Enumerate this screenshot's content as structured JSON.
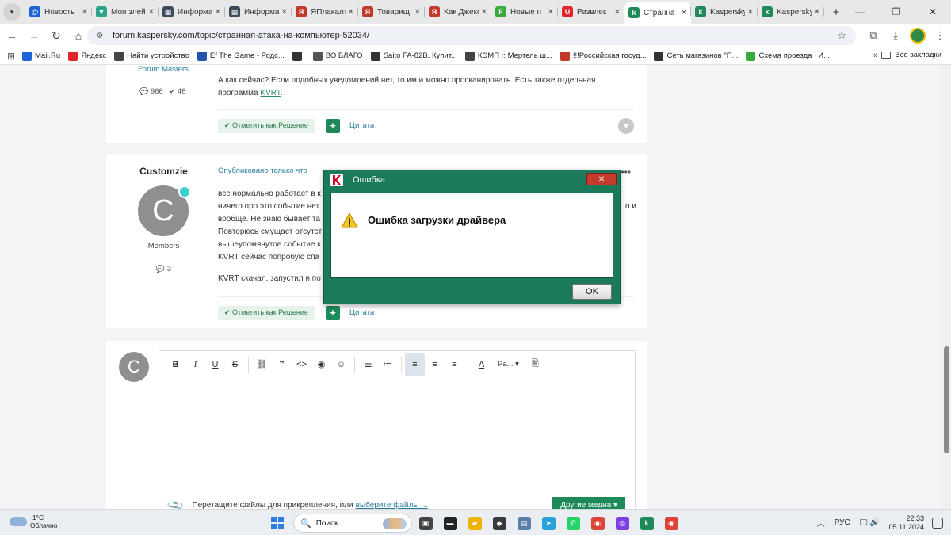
{
  "browser": {
    "tabs": [
      {
        "label": "Новость",
        "icon_char": "@",
        "color": "#1e63d6"
      },
      {
        "label": "Моя злейшая",
        "icon_char": "▼",
        "color": "#2aa58a"
      },
      {
        "label": "Информация",
        "icon_char": "▦",
        "color": "#3a4a5a"
      },
      {
        "label": "Информация",
        "icon_char": "▦",
        "color": "#3a4a5a"
      },
      {
        "label": "ЯПлакалъ",
        "icon_char": "Я",
        "color": "#c0392b"
      },
      {
        "label": "Товарищ",
        "icon_char": "Я",
        "color": "#c0392b"
      },
      {
        "label": "Как Джексон",
        "icon_char": "Я",
        "color": "#c0392b"
      },
      {
        "label": "Новые п",
        "icon_char": "F",
        "color": "#3aa83a"
      },
      {
        "label": "Развлек",
        "icon_char": "U",
        "color": "#e0262b"
      },
      {
        "label": "Странна",
        "icon_char": "k",
        "color": "#1e8a5a"
      },
      {
        "label": "Kaspersky",
        "icon_char": "k",
        "color": "#1e8a5a"
      },
      {
        "label": "Kaspersky",
        "icon_char": "k",
        "color": "#1e8a5a"
      }
    ],
    "active_tab": 9,
    "url": "forum.kaspersky.com/topic/странная-атака-на-компьютер-52034/",
    "bookmarks": [
      {
        "label": "Mail.Ru",
        "color": "#1e63d6"
      },
      {
        "label": "Яндекс",
        "color": "#e0262b"
      },
      {
        "label": "Найти устройство",
        "color": "#444444"
      },
      {
        "label": "Ef The Game - Родс...",
        "color": "#2255aa"
      },
      {
        "label": "",
        "color": "#333333"
      },
      {
        "label": "ВО БЛАГО",
        "color": "#555555"
      },
      {
        "label": "Saito FA-82B. Купит...",
        "color": "#333333"
      },
      {
        "label": "КЭМП :: Мертель ш...",
        "color": "#444444"
      },
      {
        "label": "!!!Российская госуд...",
        "color": "#c0392b"
      },
      {
        "label": "Сеть магазинов \"П...",
        "color": "#333333"
      },
      {
        "label": "Схема проезда | И...",
        "color": "#3aa83a"
      }
    ],
    "bookmarks_more": "»",
    "all_bookmarks": "Все закладки"
  },
  "post1": {
    "author_group": "Forum Masters",
    "posts_count": "966",
    "reputation": "46",
    "text_line1": "А как сейчас? Если подобных уведомлений нет, то им и можно просканировать. Есть также отдельная",
    "text_line2_prefix": "программа ",
    "text_link": "KVRT",
    "text_line2_suffix": ".",
    "solve_label": "✔ Отметить как Решение",
    "quote_label": "Цитата"
  },
  "post2": {
    "author": "Customzie",
    "avatar_letter": "C",
    "group": "Members",
    "posts_count": "3",
    "published": "Опубликовано только что",
    "lines": [
      "все нормально работает в к",
      "ничего про это событие нет",
      "вообще. Не знаю бывает та",
      "Повторюсь смущает отсутст",
      "вышеупомянутое событие к",
      "KVRT сейчас попробую спа"
    ],
    "line_right_1": "о и",
    "line2": "KVRT скачал, запустил и по",
    "solve_label": "✔ Отметить как Решение",
    "quote_label": "Цитата"
  },
  "editor": {
    "avatar_letter": "C",
    "paragraph_combo": "Pa... ▾",
    "attach_text": "Перетащите файлы для прикрепления, или ",
    "attach_link": "выберите файлы ...",
    "media_button": "Другие медиа ▾"
  },
  "dialog": {
    "title": "Ошибка",
    "message": "Ошибка загрузки драйвера",
    "ok_label": "OK",
    "close_label": "✕"
  },
  "taskbar": {
    "temperature": "-1°C",
    "weather": "Облачно",
    "search_placeholder": "Поиск",
    "language": "РУС",
    "time": "22:33",
    "date": "05.11.2024",
    "apps": [
      {
        "name": "task-view",
        "color": "#444444",
        "char": "▣"
      },
      {
        "name": "terminal",
        "color": "#222222",
        "char": "▬"
      },
      {
        "name": "explorer",
        "color": "#f0b400",
        "char": "▰"
      },
      {
        "name": "app-dark",
        "color": "#3a3a3a",
        "char": "◆"
      },
      {
        "name": "photos",
        "color": "#5a7fa8",
        "char": "▤"
      },
      {
        "name": "telegram",
        "color": "#2aa1da",
        "char": "➤"
      },
      {
        "name": "whatsapp",
        "color": "#25d366",
        "char": "✆"
      },
      {
        "name": "chrome",
        "color": "#db4437",
        "char": "◉"
      },
      {
        "name": "app-purple",
        "color": "#7b3fe4",
        "char": "◎"
      },
      {
        "name": "kaspersky",
        "color": "#1e8a5a",
        "char": "k"
      },
      {
        "name": "chrome-2",
        "color": "#db4437",
        "char": "◉"
      }
    ]
  }
}
